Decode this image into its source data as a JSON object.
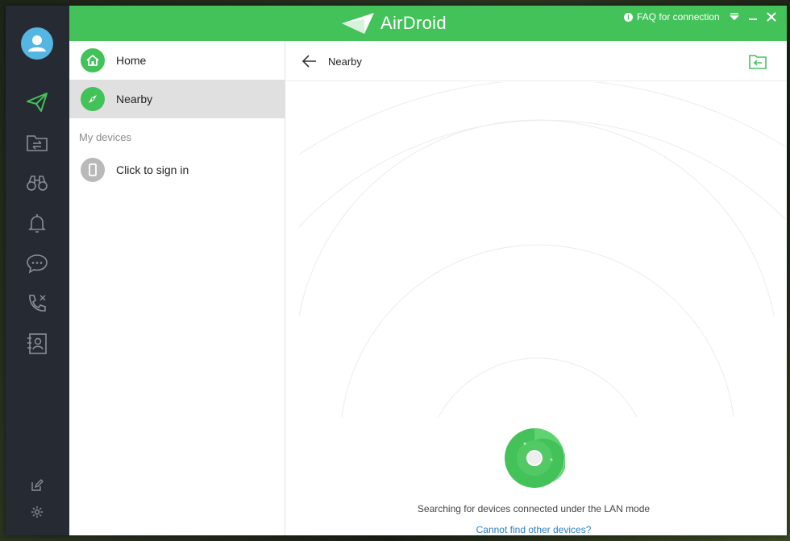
{
  "app": {
    "name": "AirDroid",
    "brand_color": "#43c25a"
  },
  "titlebar": {
    "faq_label": "FAQ for connection",
    "icons": [
      "info-icon",
      "collapse-icon",
      "minimize-icon",
      "close-icon"
    ]
  },
  "rail": {
    "items": [
      {
        "name": "send-icon",
        "active": true
      },
      {
        "name": "file-transfer-icon"
      },
      {
        "name": "binoculars-icon"
      },
      {
        "name": "bell-icon"
      },
      {
        "name": "chat-icon"
      },
      {
        "name": "calls-icon"
      },
      {
        "name": "contacts-icon"
      }
    ],
    "bottom": [
      "edit-icon",
      "settings-icon"
    ]
  },
  "sidepanel": {
    "items": [
      {
        "label": "Home",
        "icon": "home-icon",
        "color": "#43c25a"
      },
      {
        "label": "Nearby",
        "icon": "compass-icon",
        "color": "#43c25a",
        "active": true
      }
    ],
    "section_label": "My devices",
    "device": {
      "label": "Click to sign in",
      "icon": "phone-icon"
    }
  },
  "main": {
    "title": "Nearby",
    "search_text": "Searching for devices connected under the LAN mode",
    "help_link": "Cannot find other devices?"
  }
}
